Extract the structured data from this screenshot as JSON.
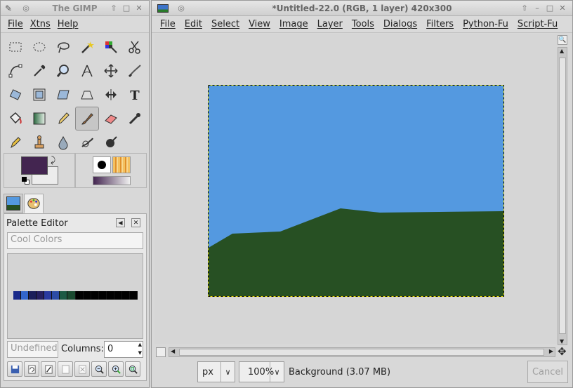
{
  "toolbox": {
    "title": "The GIMP",
    "menu": [
      "File",
      "Xtns",
      "Help"
    ],
    "tools": [
      "rect-select",
      "ellipse-select",
      "lasso",
      "fuzzy-select",
      "color-select",
      "scissors",
      "paths",
      "color-picker",
      "zoom",
      "measure",
      "move",
      "crop",
      "rotate",
      "scale",
      "shear",
      "perspective",
      "flip",
      "text",
      "bucket-fill",
      "blend",
      "pencil",
      "paintbrush",
      "eraser",
      "airbrush",
      "ink",
      "clone",
      "convolve",
      "smudge",
      "dodge-burn"
    ],
    "active_tool": "paintbrush",
    "fg_color": "#432550",
    "bg_color": "#ececec"
  },
  "palette_editor": {
    "title": "Palette Editor",
    "palette_name": "Cool Colors",
    "swatches": [
      "#1a2a8a",
      "#3366cc",
      "#1c1f5a",
      "#262060",
      "#2a3aa0",
      "#2d4ca6",
      "#1c5a44",
      "#1a4a30",
      "#000000",
      "#000000",
      "#000000",
      "#000000",
      "#000000",
      "#000000",
      "#000000",
      "#000000"
    ],
    "color_name_placeholder": "Undefined",
    "columns_label": "Columns:",
    "columns_value": "0"
  },
  "image_window": {
    "title": "*Untitled-22.0 (RGB, 1 layer) 420x300",
    "menu": [
      "File",
      "Edit",
      "Select",
      "View",
      "Image",
      "Layer",
      "Tools",
      "Dialogs",
      "Filters",
      "Python-Fu",
      "Script-Fu"
    ],
    "sky_color": "#5499e0",
    "ground_color": "#275023",
    "unit": "px",
    "zoom": "100%",
    "status": "Background (3.07 MB)",
    "cancel_label": "Cancel"
  }
}
